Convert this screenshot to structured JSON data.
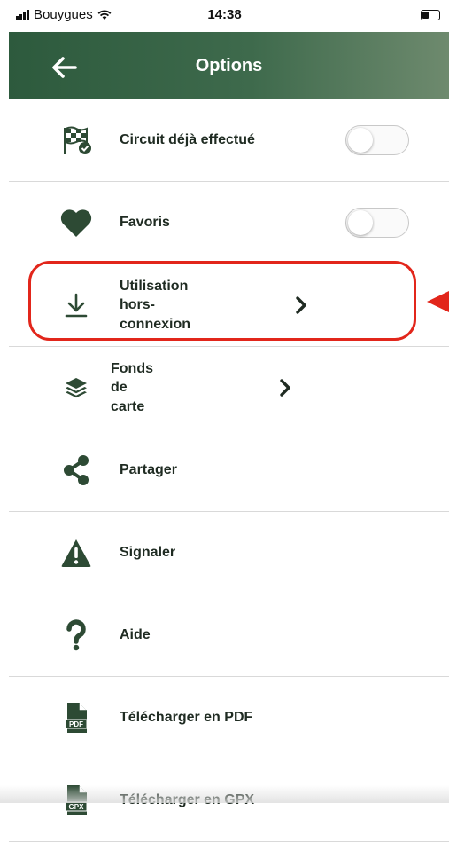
{
  "status_bar": {
    "carrier": "Bouygues",
    "time": "14:38"
  },
  "header": {
    "title": "Options",
    "back_icon": "arrow-left-icon"
  },
  "options": [
    {
      "id": "circuit-done",
      "label": "Circuit déjà effectué",
      "icon": "checkered-flag-icon",
      "control": "toggle",
      "toggle_on": false
    },
    {
      "id": "favorites",
      "label": "Favoris",
      "icon": "heart-icon",
      "control": "toggle",
      "toggle_on": false
    },
    {
      "id": "offline",
      "label_lines": [
        "Utilisation",
        "hors-",
        "connexion"
      ],
      "icon": "download-icon",
      "control": "chevron"
    },
    {
      "id": "basemaps",
      "label_lines": [
        "Fonds",
        "de",
        "carte"
      ],
      "icon": "layers-icon",
      "control": "chevron"
    },
    {
      "id": "share",
      "label": "Partager",
      "icon": "share-icon"
    },
    {
      "id": "report",
      "label": "Signaler",
      "icon": "warning-icon"
    },
    {
      "id": "help",
      "label": "Aide",
      "icon": "question-icon"
    },
    {
      "id": "download-pdf",
      "label": "Télécharger en PDF",
      "icon": "pdf-file-icon",
      "icon_text": "PDF"
    },
    {
      "id": "download-gpx",
      "label": "Télécharger en GPX",
      "icon": "gpx-file-icon",
      "icon_text": "GPX"
    }
  ],
  "annotation": {
    "highlight_color": "#e2261b",
    "highlighted_option": "offline"
  },
  "colors": {
    "header_green": "#2d5a3d",
    "icon_green": "#2d4a34"
  }
}
